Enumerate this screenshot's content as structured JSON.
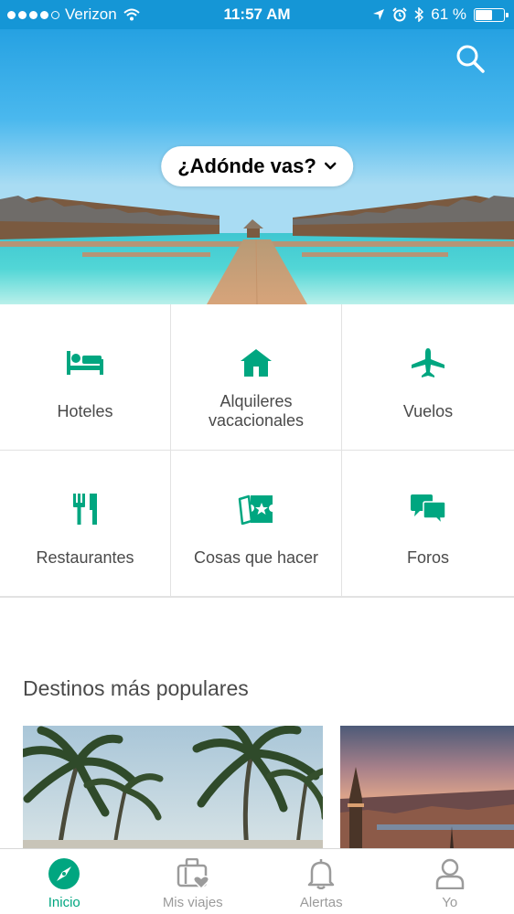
{
  "status_bar": {
    "carrier": "Verizon",
    "time": "11:57 AM",
    "battery_text": "61 %",
    "battery_level": 0.61
  },
  "hero": {
    "destination_prompt": "¿Adónde vas?",
    "icons": {
      "search": "search-icon",
      "dropdown": "chevron-down-icon"
    }
  },
  "categories": [
    {
      "label": "Hoteles",
      "icon": "bed-icon"
    },
    {
      "label": "Alquileres\nvacacionales",
      "icon": "house-icon"
    },
    {
      "label": "Vuelos",
      "icon": "airplane-icon"
    },
    {
      "label": "Restaurantes",
      "icon": "fork-knife-icon"
    },
    {
      "label": "Cosas que hacer",
      "icon": "tickets-icon"
    },
    {
      "label": "Foros",
      "icon": "chat-bubbles-icon"
    }
  ],
  "popular": {
    "title": "Destinos más populares"
  },
  "tabbar": {
    "tabs": [
      {
        "label": "Inicio",
        "icon": "compass-icon",
        "active": true
      },
      {
        "label": "Mis viajes",
        "icon": "suitcase-heart-icon",
        "active": false
      },
      {
        "label": "Alertas",
        "icon": "bell-icon",
        "active": false
      },
      {
        "label": "Yo",
        "icon": "person-icon",
        "active": false
      }
    ]
  },
  "colors": {
    "accent": "#00a680",
    "status_bar": "#1596d6",
    "inactive": "#9b9b9b",
    "text": "#4a4a4a"
  }
}
